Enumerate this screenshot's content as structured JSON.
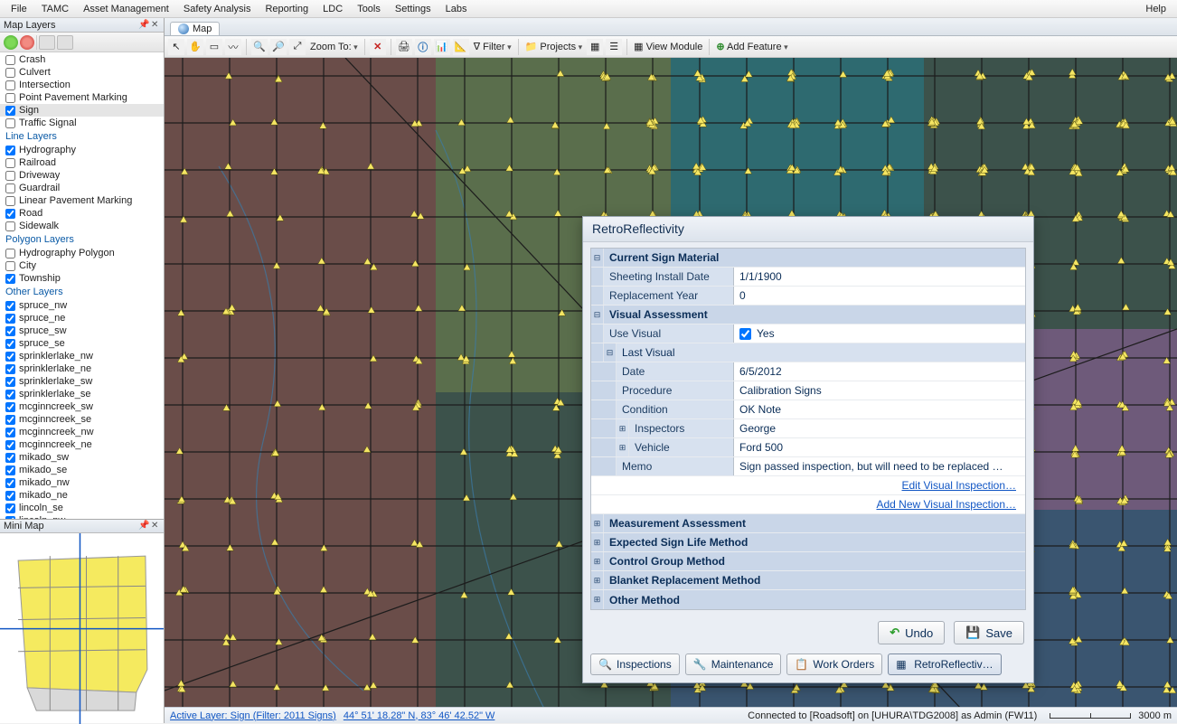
{
  "menu": [
    "File",
    "TAMC",
    "Asset Management",
    "Safety Analysis",
    "Reporting",
    "LDC",
    "Tools",
    "Settings",
    "Labs"
  ],
  "menu_help": "Help",
  "panels": {
    "map_layers_title": "Map Layers",
    "mini_map_title": "Mini Map"
  },
  "layer_groups": {
    "point": {
      "title": "",
      "items": [
        {
          "label": "Crash",
          "checked": false
        },
        {
          "label": "Culvert",
          "checked": false
        },
        {
          "label": "Intersection",
          "checked": false
        },
        {
          "label": "Point Pavement Marking",
          "checked": false
        },
        {
          "label": "Sign",
          "checked": true,
          "selected": true
        },
        {
          "label": "Traffic Signal",
          "checked": false
        }
      ]
    },
    "line": {
      "title": "Line Layers",
      "items": [
        {
          "label": "Hydrography",
          "checked": true
        },
        {
          "label": "Railroad",
          "checked": false
        },
        {
          "label": "Driveway",
          "checked": false
        },
        {
          "label": "Guardrail",
          "checked": false
        },
        {
          "label": "Linear Pavement Marking",
          "checked": false
        },
        {
          "label": "Road",
          "checked": true
        },
        {
          "label": "Sidewalk",
          "checked": false
        }
      ]
    },
    "polygon": {
      "title": "Polygon Layers",
      "items": [
        {
          "label": "Hydrography Polygon",
          "checked": false
        },
        {
          "label": "City",
          "checked": false
        },
        {
          "label": "Township",
          "checked": true
        }
      ]
    },
    "other": {
      "title": "Other Layers",
      "items": [
        {
          "label": "spruce_nw",
          "checked": true
        },
        {
          "label": "spruce_ne",
          "checked": true
        },
        {
          "label": "spruce_sw",
          "checked": true
        },
        {
          "label": "spruce_se",
          "checked": true
        },
        {
          "label": "sprinklerlake_nw",
          "checked": true
        },
        {
          "label": "sprinklerlake_ne",
          "checked": true
        },
        {
          "label": "sprinklerlake_sw",
          "checked": true
        },
        {
          "label": "sprinklerlake_se",
          "checked": true
        },
        {
          "label": "mcginncreek_sw",
          "checked": true
        },
        {
          "label": "mcginncreek_se",
          "checked": true
        },
        {
          "label": "mcginncreek_nw",
          "checked": true
        },
        {
          "label": "mcginncreek_ne",
          "checked": true
        },
        {
          "label": "mikado_sw",
          "checked": true
        },
        {
          "label": "mikado_se",
          "checked": true
        },
        {
          "label": "mikado_nw",
          "checked": true
        },
        {
          "label": "mikado_ne",
          "checked": true
        },
        {
          "label": "lincoln_se",
          "checked": true
        },
        {
          "label": "lincoln_nw",
          "checked": true
        }
      ]
    }
  },
  "tab": {
    "label": "Map"
  },
  "toolbar": {
    "zoom_to": "Zoom To:",
    "filter": "Filter",
    "projects": "Projects",
    "view_module": "View Module",
    "add_feature": "Add Feature"
  },
  "dialog": {
    "title": "RetroReflectivity",
    "sections": {
      "current_sign_material": "Current Sign Material",
      "visual_assessment": "Visual Assessment",
      "last_visual": "Last Visual",
      "measurement_assessment": "Measurement Assessment",
      "expected_sign_life": "Expected Sign Life Method",
      "control_group": "Control Group Method",
      "blanket_replacement": "Blanket Replacement Method",
      "other_method": "Other Method"
    },
    "fields": {
      "sheeting_install_date": {
        "label": "Sheeting Install Date",
        "value": "1/1/1900"
      },
      "replacement_year": {
        "label": "Replacement Year",
        "value": "0"
      },
      "use_visual": {
        "label": "Use Visual",
        "value": "Yes",
        "checked": true
      },
      "date": {
        "label": "Date",
        "value": "6/5/2012"
      },
      "procedure": {
        "label": "Procedure",
        "value": "Calibration Signs"
      },
      "condition": {
        "label": "Condition",
        "value": "OK Note"
      },
      "inspectors": {
        "label": "Inspectors",
        "value": "George"
      },
      "vehicle": {
        "label": "Vehicle",
        "value": "Ford 500"
      },
      "memo": {
        "label": "Memo",
        "value": "Sign passed inspection, but will need to be replaced …"
      }
    },
    "links": {
      "edit": "Edit Visual Inspection…",
      "add": "Add New Visual Inspection…"
    },
    "buttons": {
      "undo": "Undo",
      "save": "Save"
    },
    "tabs": [
      "Inspections",
      "Maintenance",
      "Work Orders",
      "RetroReflectiv…"
    ]
  },
  "status": {
    "active_layer": "Active Layer: Sign (Filter: 2011 Signs)",
    "coords": "44° 51' 18.28\" N, 83° 46' 42.52\" W",
    "connection": "Connected to [Roadsoft] on [UHURA\\TDG2008] as Admin (FW11)",
    "scale": "3000 m"
  }
}
